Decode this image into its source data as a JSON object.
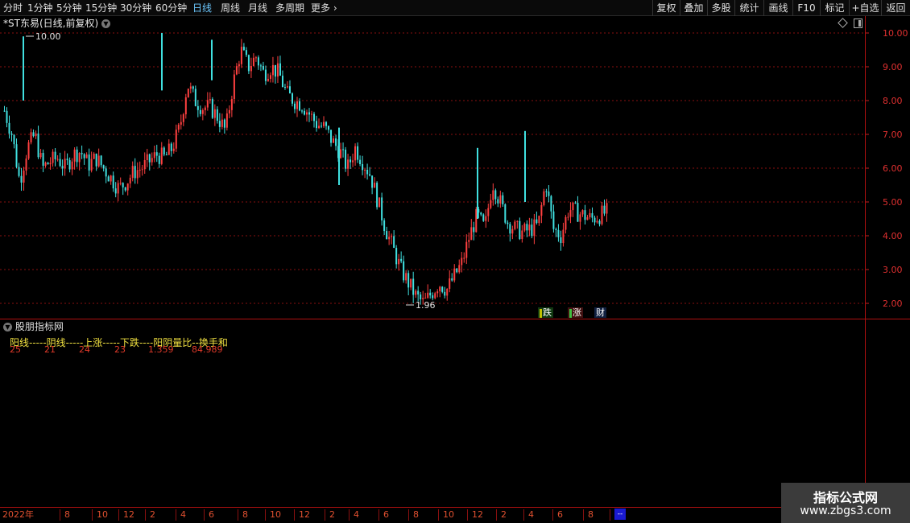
{
  "toolbar": {
    "periods": [
      "分时",
      "1分钟",
      "5分钟",
      "15分钟",
      "30分钟",
      "60分钟",
      "日线",
      "周线",
      "月线",
      "多周期",
      "更多"
    ],
    "active_period": "日线",
    "buttons": [
      "复权",
      "叠加",
      "多股",
      "统计",
      "画线",
      "F10",
      "标记",
      "+自选",
      "返回"
    ]
  },
  "chart": {
    "title": "*ST东易(日线,前复权)",
    "price_labels": [
      "10.00",
      "9.00",
      "8.00",
      "7.00",
      "6.00",
      "5.00",
      "4.00",
      "3.00",
      "2.00"
    ],
    "high_marker": "10.00",
    "low_marker": "1.96",
    "badges": [
      "跌",
      "涨",
      "财"
    ]
  },
  "indicator": {
    "title": "股朋指标网",
    "labels": "阳线-----阴线-----上涨-----下跌----阳阴量比--换手和",
    "values": [
      "25",
      "21",
      "24",
      "23",
      "1.359",
      "84.989"
    ]
  },
  "time_axis": {
    "labels": [
      "2022年",
      "8",
      "10",
      "12",
      "2",
      "4",
      "6",
      "8",
      "10",
      "12",
      "2",
      "4",
      "6",
      "8",
      "10",
      "12",
      "2",
      "4",
      "6",
      "8"
    ],
    "end_marker": "--"
  },
  "watermark": {
    "title": "指标公式网",
    "url": "www.zbgs3.com"
  },
  "colors": {
    "up": "#ff4040",
    "down": "#40e0e0",
    "grid": "#8a1010",
    "accent": "#6cc8ff"
  },
  "chart_data": {
    "type": "candlestick",
    "ylim": [
      1.8,
      10.3
    ],
    "close_series": [
      7.7,
      7.0,
      5.6,
      6.6,
      7.0,
      6.0,
      6.2,
      6.3,
      6.0,
      6.4,
      6.5,
      6.1,
      6.3,
      6.0,
      5.7,
      5.4,
      5.6,
      5.9,
      6.0,
      6.2,
      6.4,
      6.3,
      6.6,
      7.2,
      8.5,
      8.0,
      7.8,
      7.8,
      7.5,
      7.1,
      8.5,
      9.5,
      9.0,
      9.3,
      8.8,
      9.0,
      8.8,
      8.2,
      8.0,
      7.9,
      7.6,
      7.3,
      7.2,
      6.8,
      6.5,
      6.0,
      6.6,
      6.2,
      5.8,
      5.0,
      4.2,
      3.6,
      3.0,
      2.6,
      2.2,
      2.0,
      2.3,
      2.6,
      2.4,
      2.8,
      3.2,
      4.0,
      4.6,
      4.2,
      5.6,
      5.0,
      4.4,
      4.2,
      4.1,
      4.2,
      4.3,
      5.6,
      4.2,
      4.0,
      4.8,
      4.7,
      4.6,
      4.5,
      4.6,
      4.7
    ]
  }
}
